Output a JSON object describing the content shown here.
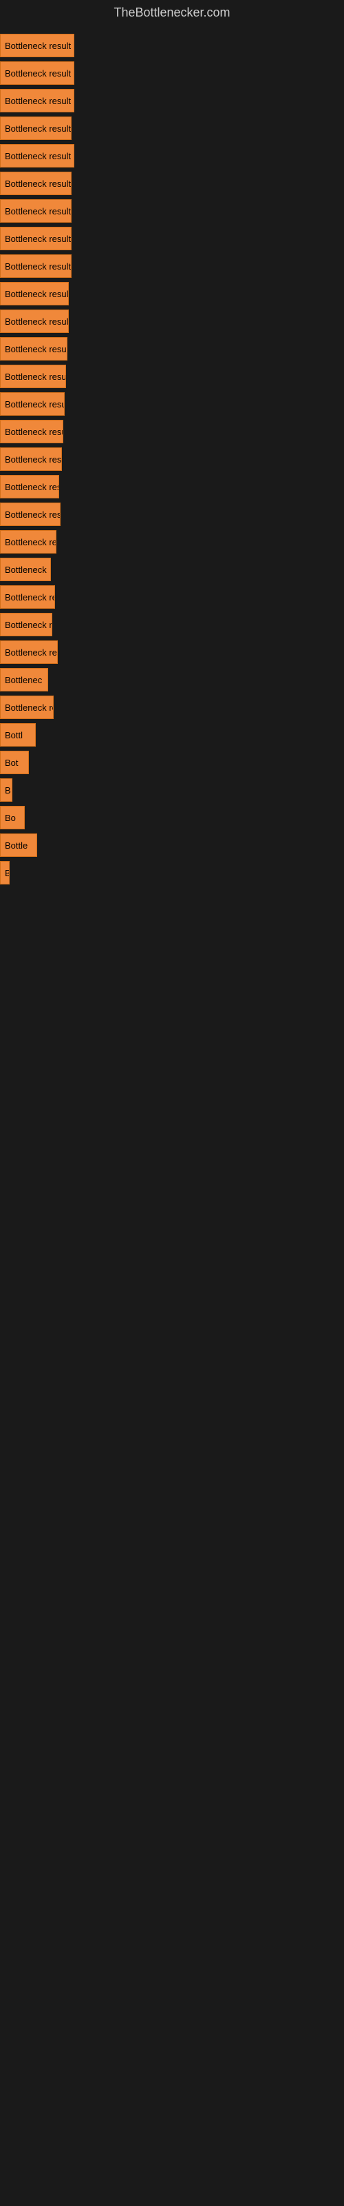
{
  "header": {
    "title": "TheBottlenecker.com"
  },
  "bars": [
    {
      "label": "Bottleneck result",
      "width": 108
    },
    {
      "label": "Bottleneck result",
      "width": 108
    },
    {
      "label": "Bottleneck result",
      "width": 108
    },
    {
      "label": "Bottleneck result",
      "width": 104
    },
    {
      "label": "Bottleneck result",
      "width": 108
    },
    {
      "label": "Bottleneck result",
      "width": 104
    },
    {
      "label": "Bottleneck result",
      "width": 104
    },
    {
      "label": "Bottleneck result",
      "width": 104
    },
    {
      "label": "Bottleneck result",
      "width": 104
    },
    {
      "label": "Bottleneck result",
      "width": 100
    },
    {
      "label": "Bottleneck result",
      "width": 100
    },
    {
      "label": "Bottleneck result",
      "width": 98
    },
    {
      "label": "Bottleneck result",
      "width": 96
    },
    {
      "label": "Bottleneck result",
      "width": 94
    },
    {
      "label": "Bottleneck result",
      "width": 92
    },
    {
      "label": "Bottleneck result",
      "width": 90
    },
    {
      "label": "Bottleneck res",
      "width": 86
    },
    {
      "label": "Bottleneck result",
      "width": 88
    },
    {
      "label": "Bottleneck re",
      "width": 82
    },
    {
      "label": "Bottleneck",
      "width": 74
    },
    {
      "label": "Bottleneck re",
      "width": 80
    },
    {
      "label": "Bottleneck r",
      "width": 76
    },
    {
      "label": "Bottleneck resu",
      "width": 84
    },
    {
      "label": "Bottlenec",
      "width": 70
    },
    {
      "label": "Bottleneck re",
      "width": 78
    },
    {
      "label": "Bottl",
      "width": 52
    },
    {
      "label": "Bot",
      "width": 42
    },
    {
      "label": "B",
      "width": 18
    },
    {
      "label": "Bo",
      "width": 36
    },
    {
      "label": "Bottle",
      "width": 54
    },
    {
      "label": "B",
      "width": 14
    },
    {
      "label": "",
      "width": 0
    },
    {
      "label": "",
      "width": 0
    },
    {
      "label": "",
      "width": 0
    },
    {
      "label": "",
      "width": 0
    },
    {
      "label": "",
      "width": 0
    },
    {
      "label": "",
      "width": 0
    }
  ]
}
